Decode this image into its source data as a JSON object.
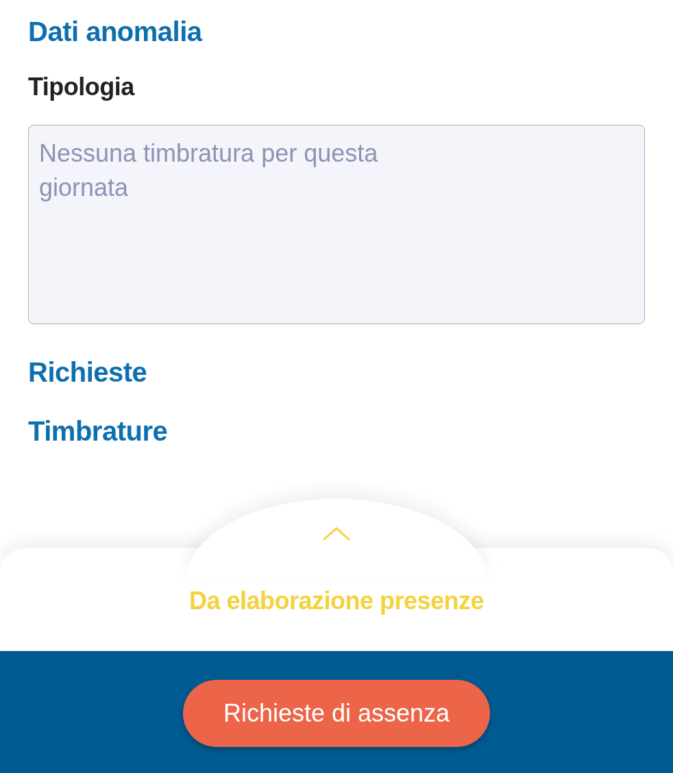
{
  "anomaly_section": {
    "title": "Dati anomalia",
    "field_label": "Tipologia",
    "field_value": "Nessuna timbratura per questa giornata"
  },
  "collapsed_sections": [
    {
      "title": "Richieste"
    },
    {
      "title": "Timbrature"
    }
  ],
  "bottom_sheet": {
    "expanded": false,
    "subtitle": "Da elaborazione presenze"
  },
  "footer": {
    "button": "Richieste di assenza"
  }
}
